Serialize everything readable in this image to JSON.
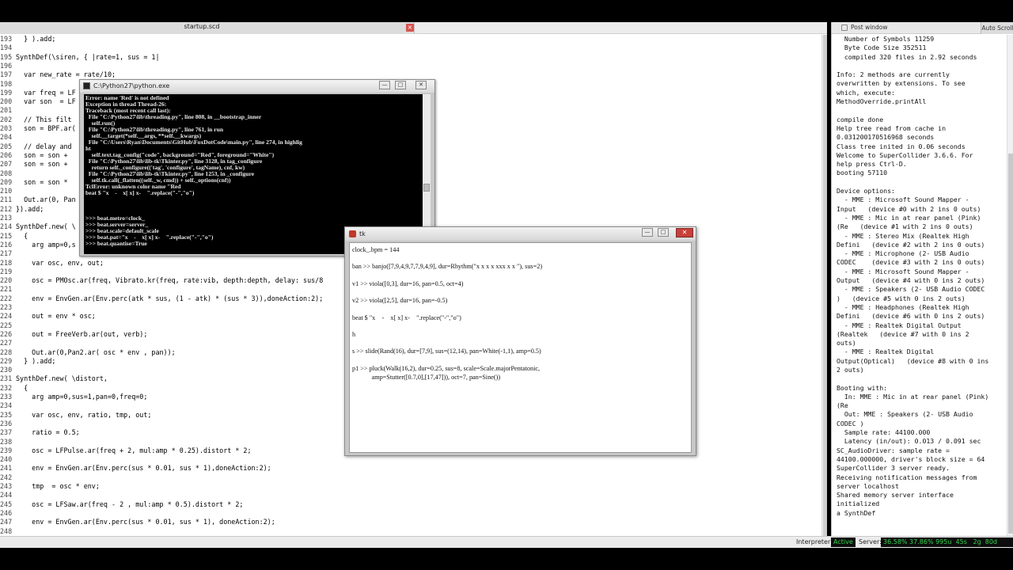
{
  "editor": {
    "tab_title": "startup.scd",
    "tab_close": "×",
    "lines": [
      {
        "n": "193",
        "t": "  } ).add;"
      },
      {
        "n": "194",
        "t": ""
      },
      {
        "n": "195",
        "t": "SynthDef(\\siren, { |rate=1, sus = 1|"
      },
      {
        "n": "196",
        "t": ""
      },
      {
        "n": "197",
        "t": "  var new_rate = rate/10;"
      },
      {
        "n": "198",
        "t": ""
      },
      {
        "n": "199",
        "t": "  var freq = LF"
      },
      {
        "n": "200",
        "t": "  var son  = LF"
      },
      {
        "n": "201",
        "t": ""
      },
      {
        "n": "202",
        "t": "  // This filt"
      },
      {
        "n": "203",
        "t": "  son = BPF.ar("
      },
      {
        "n": "204",
        "t": ""
      },
      {
        "n": "205",
        "t": "  // delay and"
      },
      {
        "n": "206",
        "t": "  son = son + "
      },
      {
        "n": "207",
        "t": "  son = son + "
      },
      {
        "n": "208",
        "t": ""
      },
      {
        "n": "209",
        "t": "  son = son * "
      },
      {
        "n": "210",
        "t": ""
      },
      {
        "n": "211",
        "t": "  Out.ar(0, Pan"
      },
      {
        "n": "212",
        "t": "}).add;"
      },
      {
        "n": "213",
        "t": ""
      },
      {
        "n": "214",
        "t": "SynthDef.new( \\"
      },
      {
        "n": "215",
        "t": "  {"
      },
      {
        "n": "216",
        "t": "    arg amp=0,s"
      },
      {
        "n": "217",
        "t": ""
      },
      {
        "n": "218",
        "t": "    var osc, env, out;"
      },
      {
        "n": "219",
        "t": ""
      },
      {
        "n": "220",
        "t": "    osc = PMOsc.ar(freq, Vibrato.kr(freq, rate:vib, depth:depth, delay: sus/8"
      },
      {
        "n": "221",
        "t": ""
      },
      {
        "n": "222",
        "t": "    env = EnvGen.ar(Env.perc(atk * sus, (1 - atk) * (sus * 3)),doneAction:2);"
      },
      {
        "n": "223",
        "t": ""
      },
      {
        "n": "224",
        "t": "    out = env * osc;"
      },
      {
        "n": "225",
        "t": ""
      },
      {
        "n": "226",
        "t": "    out = FreeVerb.ar(out, verb);"
      },
      {
        "n": "227",
        "t": ""
      },
      {
        "n": "228",
        "t": "    Out.ar(0,Pan2.ar( osc * env , pan));"
      },
      {
        "n": "229",
        "t": "  } ).add;"
      },
      {
        "n": "230",
        "t": ""
      },
      {
        "n": "231",
        "t": "SynthDef.new( \\distort,"
      },
      {
        "n": "232",
        "t": "  {"
      },
      {
        "n": "233",
        "t": "    arg amp=0,sus=1,pan=0,freq=0;"
      },
      {
        "n": "234",
        "t": ""
      },
      {
        "n": "235",
        "t": "    var osc, env, ratio, tmp, out;"
      },
      {
        "n": "236",
        "t": ""
      },
      {
        "n": "237",
        "t": "    ratio = 0.5;"
      },
      {
        "n": "238",
        "t": ""
      },
      {
        "n": "239",
        "t": "    osc = LFPulse.ar(freq + 2, mul:amp * 0.25).distort * 2;"
      },
      {
        "n": "240",
        "t": ""
      },
      {
        "n": "241",
        "t": "    env = EnvGen.ar(Env.perc(sus * 0.01, sus * 1),doneAction:2);"
      },
      {
        "n": "242",
        "t": ""
      },
      {
        "n": "243",
        "t": "    tmp  = osc * env;"
      },
      {
        "n": "244",
        "t": ""
      },
      {
        "n": "245",
        "t": "    osc = LFSaw.ar(freq - 2 , mul:amp * 0.5).distort * 2;"
      },
      {
        "n": "246",
        "t": ""
      },
      {
        "n": "247",
        "t": "    env = EnvGen.ar(Env.perc(sus * 0.01, sus * 1), doneAction:2);"
      },
      {
        "n": "248",
        "t": ""
      }
    ]
  },
  "python_window": {
    "title": "C:\\Python27\\python.exe",
    "text": "Error: name 'Red' is not defined\nException in thread Thread-26:\nTraceback (most recent call last):\n  File \"C:\\Python27\\lib\\threading.py\", line 808, in __bootstrap_inner\n    self.run()\n  File \"C:\\Python27\\lib\\threading.py\", line 761, in run\n    self.__target(*self.__args, **self.__kwargs)\n  File \"C:\\Users\\Ryan\\Documents\\GitHub\\FoxDotCode\\main.py\", line 274, in highlig\nht\n    self.text.tag_config(\"code\", background=\"Red\", foreground=\"White\")\n  File \"C:\\Python27\\lib\\lib-tk\\Tkinter.py\", line 3128, in tag_configure\n    return self._configure(('tag', 'configure', tagName), cnf, kw)\n  File \"C:\\Python27\\lib\\lib-tk\\Tkinter.py\", line 1253, in _configure\n    self.tk.call(_flatten((self._w, cmd)) + self._options(cnf))\nTclError: unknown color name \"Red\nbeat $ \"x    -    x[ x] x-    \".replace(\"-\",\"o\")\n\n\n\n>>> beat.metro=clock_\n>>> beat.server=server_\n>>> beat.scale=default_scale\n>>> beat.pat=\"x    -    x[ x] x-    \".replace(\"-\",\"o\")\n>>> beat.quantise=True"
  },
  "tk_window": {
    "title": "tk",
    "close": "✕",
    "lines": [
      "clock_.bpm = 144",
      "",
      "ban >> banjo([7,9,4,9,7,7,9,4,9], dur=Rhythm(\"x x x x xxx x x \"), sus=2)",
      "",
      "v1 >> viola([0,3], dur=16, pan=0.5, oct=4)",
      "",
      "v2 >> viola([2,5], dur=16, pan=-0.5)",
      "",
      "beat $ \"x    -    x[ x] x-    \".replace(\"-\",\"o\")",
      "",
      "h",
      "",
      "s >> slide(Rand(16), dur=[7,9], sus=(12,14), pan=White(-1,1), amp=0.5)",
      "",
      "p1 >> pluck(Walk(16,2), dur=0.25, sus=8, scale=Scale.majorPentatonic,",
      "            amp=Stutter([0.7,0],[17,47])), oct=7, pan=Sine())"
    ]
  },
  "post_window": {
    "title": "Post window",
    "autoscroll": "Auto Scroll",
    "text": "  Number of Symbols 11259\n  Byte Code Size 352511\n  compiled 320 files in 2.92 seconds\n\nInfo: 2 methods are currently\noverwritten by extensions. To see\nwhich, execute:\nMethodOverride.printAll\n\ncompile done\nHelp tree read from cache in\n0.031200170516968 seconds\nClass tree inited in 0.06 seconds\nWelcome to SuperCollider 3.6.6. For\nhelp press Ctrl-D.\nbooting 57110\n\nDevice options:\n  - MME : Microsoft Sound Mapper -\nInput   (device #0 with 2 ins 0 outs)\n  - MME : Mic in at rear panel (Pink)\n(Re   (device #1 with 2 ins 0 outs)\n  - MME : Stereo Mix (Realtek High\nDefini   (device #2 with 2 ins 0 outs)\n  - MME : Microphone (2- USB Audio\nCODEC    (device #3 with 2 ins 0 outs)\n  - MME : Microsoft Sound Mapper -\nOutput   (device #4 with 0 ins 2 outs)\n  - MME : Speakers (2- USB Audio CODEC\n)   (device #5 with 0 ins 2 outs)\n  - MME : Headphones (Realtek High\nDefini   (device #6 with 0 ins 2 outs)\n  - MME : Realtek Digital Output\n(Realtek   (device #7 with 0 ins 2\nouts)\n  - MME : Realtek Digital\nOutput(Optical)   (device #8 with 0 ins\n2 outs)\n\nBooting with:\n  In: MME : Mic in at rear panel (Pink)\n(Re\n  Out: MME : Speakers (2- USB Audio\nCODEC )\n  Sample rate: 44100.000\n  Latency (in/out): 0.013 / 0.091 sec\nSC_AudioDriver: sample rate =\n44100.000000, driver's block size = 64\nSuperCollider 3 server ready.\nReceiving notification messages from\nserver localhost\nShared memory server interface\ninitialized\na SynthDef"
  },
  "status": {
    "interpreter_label": "Interpreter:",
    "interpreter_value": "Active",
    "server_label": "Server:",
    "server_value": "36.58% 37.86% 995u  45s   2g  80d"
  }
}
